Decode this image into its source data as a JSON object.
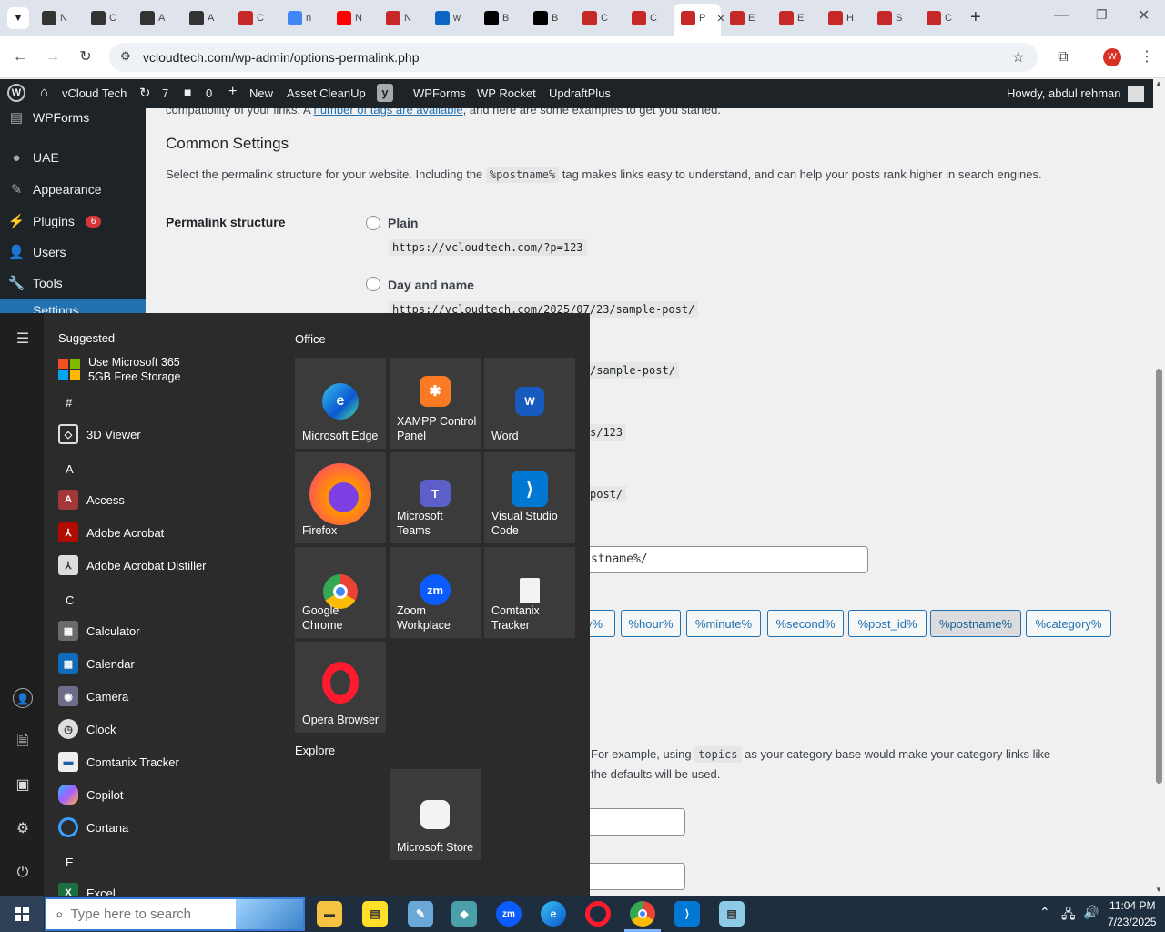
{
  "browser": {
    "tabs": [
      {
        "letter": "N",
        "icon": "openai-icon"
      },
      {
        "letter": "C",
        "icon": "openai-icon"
      },
      {
        "letter": "A",
        "icon": "openai-icon"
      },
      {
        "letter": "A",
        "icon": "openai-icon"
      },
      {
        "letter": "C",
        "icon": "app-icon"
      },
      {
        "letter": "n",
        "icon": "google-icon"
      },
      {
        "letter": "N",
        "icon": "youtube-icon"
      },
      {
        "letter": "N",
        "icon": "app-icon"
      },
      {
        "letter": "w",
        "icon": "linkedin-icon"
      },
      {
        "letter": "B",
        "icon": "x-icon"
      },
      {
        "letter": "B",
        "icon": "x-icon"
      },
      {
        "letter": "C",
        "icon": "app-icon"
      },
      {
        "letter": "C",
        "icon": "app-icon"
      },
      {
        "letter": "P",
        "icon": "app-icon",
        "active": true
      },
      {
        "letter": "E",
        "icon": "app-icon"
      },
      {
        "letter": "E",
        "icon": "app-icon"
      },
      {
        "letter": "H",
        "icon": "app-icon"
      },
      {
        "letter": "S",
        "icon": "app-icon"
      },
      {
        "letter": "C",
        "icon": "app-icon"
      }
    ],
    "url": "vcloudtech.com/wp-admin/options-permalink.php",
    "profile_initial": "W"
  },
  "adminbar": {
    "site": "vCloud Tech",
    "updates": "7",
    "comments": "0",
    "new": "New",
    "items": [
      "Asset CleanUp",
      "WPForms",
      "WP Rocket",
      "UpdraftPlus"
    ],
    "howdy": "Howdy, abdul rehman"
  },
  "sidemenu": {
    "items": [
      "WPForms",
      "UAE",
      "Appearance",
      "Plugins",
      "Users",
      "Tools",
      "Settings"
    ],
    "plugins_badge": "6"
  },
  "content": {
    "intro_fragment": "compatibility of your links. A",
    "intro_link": "number of tags are available",
    "intro_rest": ", and here are some examples to get you started.",
    "heading": "Common Settings",
    "desc_1": "Select the permalink structure for your website. Including the",
    "desc_code": "%postname%",
    "desc_2": "tag makes links easy to understand, and can help your posts rank higher in search engines.",
    "permalink_label": "Permalink structure",
    "options": [
      {
        "label": "Plain",
        "example": "https://vcloudtech.com/?p=123"
      },
      {
        "label": "Day and name",
        "example": "https://vcloudtech.com/2025/07/23/sample-post/"
      }
    ],
    "visible_fragments": [
      "/sample-post/",
      "s/123",
      "post/",
      "stname%/"
    ],
    "tag_buttons": [
      "y%",
      "%hour%",
      "%minute%",
      "%second%",
      "%post_id%",
      "%postname%",
      "%category%"
    ],
    "optional_1": "For example, using",
    "optional_code": "topics",
    "optional_2": "as your category base would make your category links like",
    "optional_3": "the defaults will be used."
  },
  "startmenu": {
    "suggested_header": "Suggested",
    "suggested_item_line1": "Use Microsoft 365",
    "suggested_item_line2": "5GB Free Storage",
    "letters": [
      "#",
      "A",
      "C",
      "E"
    ],
    "apps": [
      "3D Viewer",
      "Access",
      "Adobe Acrobat",
      "Adobe Acrobat Distiller",
      "Calculator",
      "Calendar",
      "Camera",
      "Clock",
      "Comtanix Tracker",
      "Copilot",
      "Cortana",
      "Excel"
    ],
    "office_header": "Office",
    "tiles": [
      {
        "l1": "Microsoft Edge",
        "l2": ""
      },
      {
        "l1": "XAMPP Control",
        "l2": "Panel"
      },
      {
        "l1": "Word",
        "l2": ""
      },
      {
        "l1": "Firefox",
        "l2": ""
      },
      {
        "l1": "Microsoft",
        "l2": "Teams"
      },
      {
        "l1": "Visual Studio",
        "l2": "Code"
      },
      {
        "l1": "Google Chrome",
        "l2": ""
      },
      {
        "l1": "Zoom",
        "l2": "Workplace"
      },
      {
        "l1": "Comtanix",
        "l2": "Tracker"
      },
      {
        "l1": "Opera Browser",
        "l2": ""
      }
    ],
    "explore_header": "Explore",
    "explore_tile": "Microsoft Store"
  },
  "taskbar": {
    "search_placeholder": "Type here to search",
    "time": "11:04 PM",
    "date": "7/23/2025"
  },
  "colors": {
    "wp_dark": "#1d2327",
    "wp_blue": "#2271b1",
    "badge_red": "#d63638",
    "start_bg": "#2b2b2b",
    "taskbar_bg": "#1f2e3f"
  }
}
